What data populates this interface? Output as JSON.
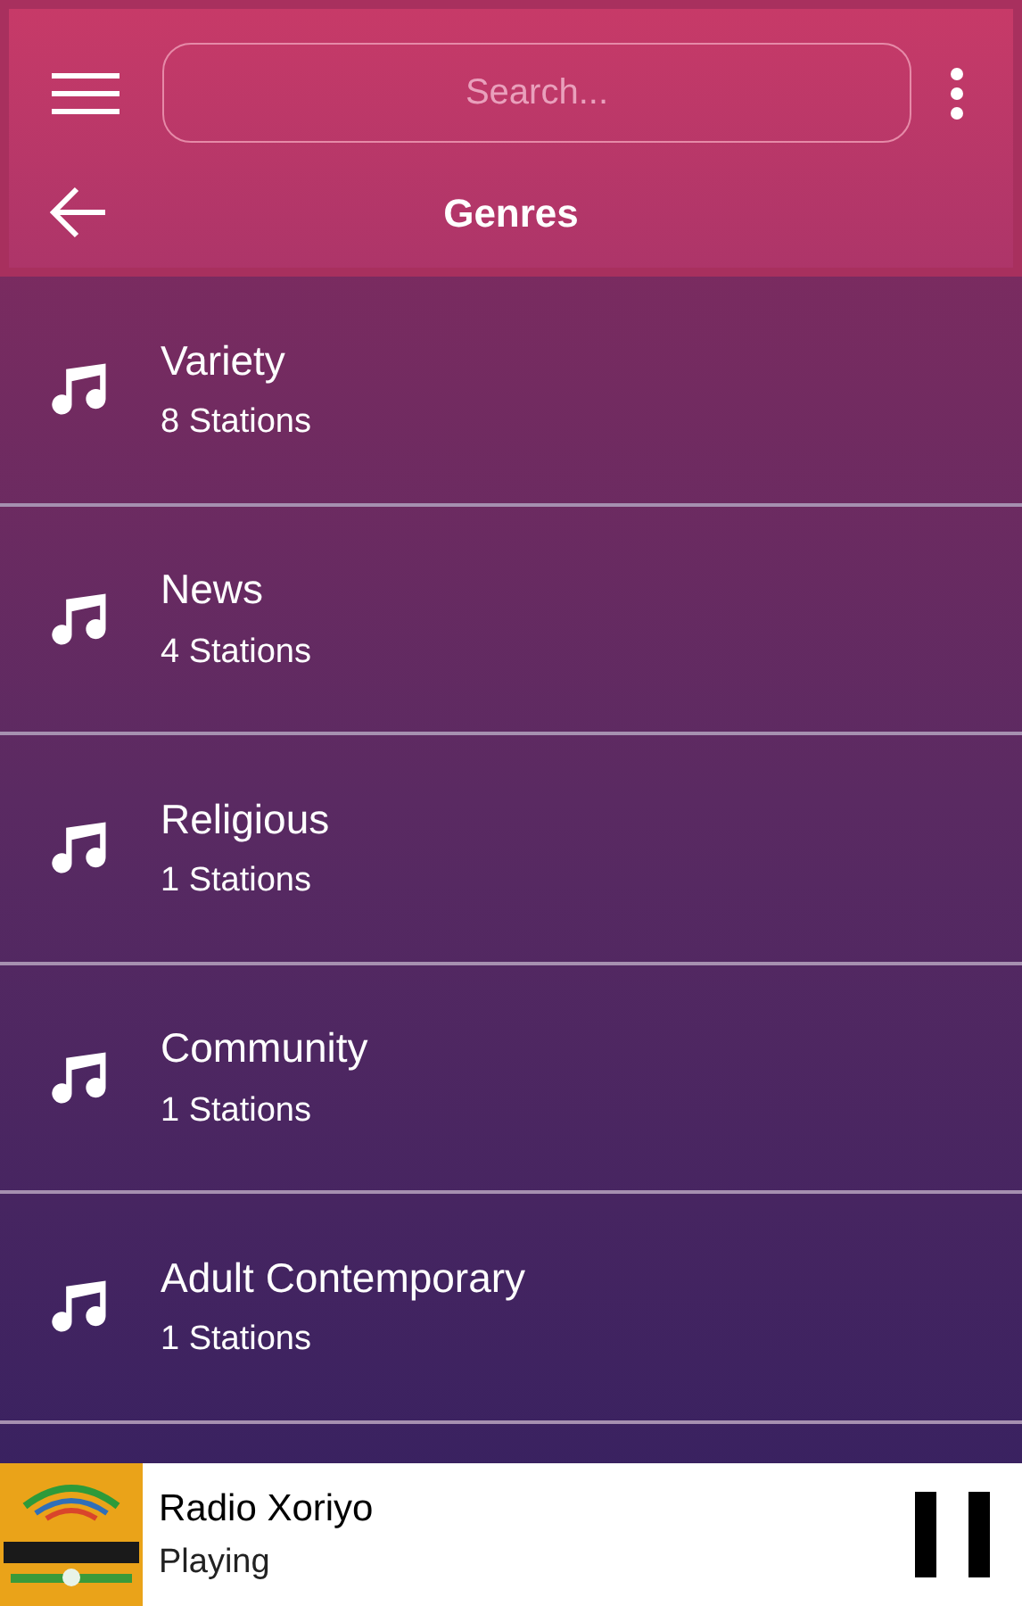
{
  "search": {
    "placeholder": "Search..."
  },
  "title": "Genres",
  "genres": [
    {
      "name": "Variety",
      "count": "8 Stations"
    },
    {
      "name": "News",
      "count": "4 Stations"
    },
    {
      "name": "Religious",
      "count": "1 Stations"
    },
    {
      "name": "Community",
      "count": "1 Stations"
    },
    {
      "name": "Adult Contemporary",
      "count": "1 Stations"
    }
  ],
  "player": {
    "station": "Radio Xoriyo",
    "status": "Playing",
    "playing": true
  }
}
